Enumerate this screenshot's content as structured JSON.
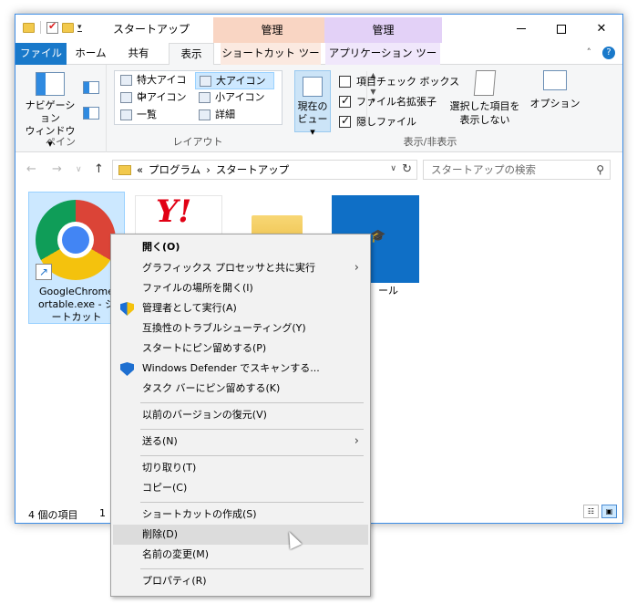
{
  "window": {
    "title": "スタートアップ",
    "context_tab_shortcut": "管理",
    "context_tab_app": "管理"
  },
  "tabs": {
    "file": "ファイル",
    "home": "ホーム",
    "share": "共有",
    "view": "表示",
    "shortcut_tools": "ショートカット ツール",
    "app_tools": "アプリケーション ツール"
  },
  "ribbon": {
    "pane_group": {
      "nav_pane_line1": "ナビゲーション",
      "nav_pane_line2": "ウィンドウ ▾",
      "label": "ペイン"
    },
    "layout_group": {
      "label": "レイアウト",
      "items": [
        "特大アイコン",
        "大アイコン",
        "中アイコン",
        "小アイコン",
        "一覧",
        "詳細"
      ],
      "selected": "大アイコン"
    },
    "current_view": {
      "line1": "現在の",
      "line2": "ビュー ▾"
    },
    "show_hide_group": {
      "label": "表示/非表示",
      "checkboxes": [
        {
          "label": "項目チェック ボックス",
          "checked": false
        },
        {
          "label": "ファイル名拡張子",
          "checked": true
        },
        {
          "label": "隠しファイル",
          "checked": true
        }
      ],
      "hide_selected_line1": "選択した項目を",
      "hide_selected_line2": "表示しない"
    },
    "options": "オプション"
  },
  "address": {
    "prefix": "«",
    "crumbs": [
      "プログラム",
      "›",
      "スタートアップ"
    ],
    "search_placeholder": "スタートアップの検索"
  },
  "files": [
    {
      "name_line1": "GoogleChrome",
      "name_line2": "ortable.exe - シ",
      "name_line3": "ートカット",
      "selected": true
    },
    {
      "name_line1": "",
      "selected": false
    },
    {
      "name_line1": "",
      "selected": false
    },
    {
      "name_line1": "ール",
      "selected": false
    }
  ],
  "status": {
    "count": "4 個の項目",
    "selected": "1"
  },
  "context_menu": [
    {
      "label": "開く(O)",
      "bold": true
    },
    {
      "label": "グラフィックス プロセッサと共に実行",
      "submenu": true
    },
    {
      "label": "ファイルの場所を開く(I)"
    },
    {
      "label": "管理者として実行(A)",
      "icon": "uac-shield-icon"
    },
    {
      "label": "互換性のトラブルシューティング(Y)"
    },
    {
      "label": "スタートにピン留めする(P)"
    },
    {
      "label": "Windows Defender でスキャンする...",
      "icon": "defender-icon"
    },
    {
      "label": "タスク バーにピン留めする(K)"
    },
    {
      "label": "以前のバージョンの復元(V)"
    },
    {
      "label": "送る(N)",
      "submenu": true
    },
    {
      "label": "切り取り(T)"
    },
    {
      "label": "コピー(C)"
    },
    {
      "label": "ショートカットの作成(S)"
    },
    {
      "label": "削除(D)",
      "highlighted": true
    },
    {
      "label": "名前の変更(M)"
    },
    {
      "label": "プロパティ(R)"
    }
  ]
}
